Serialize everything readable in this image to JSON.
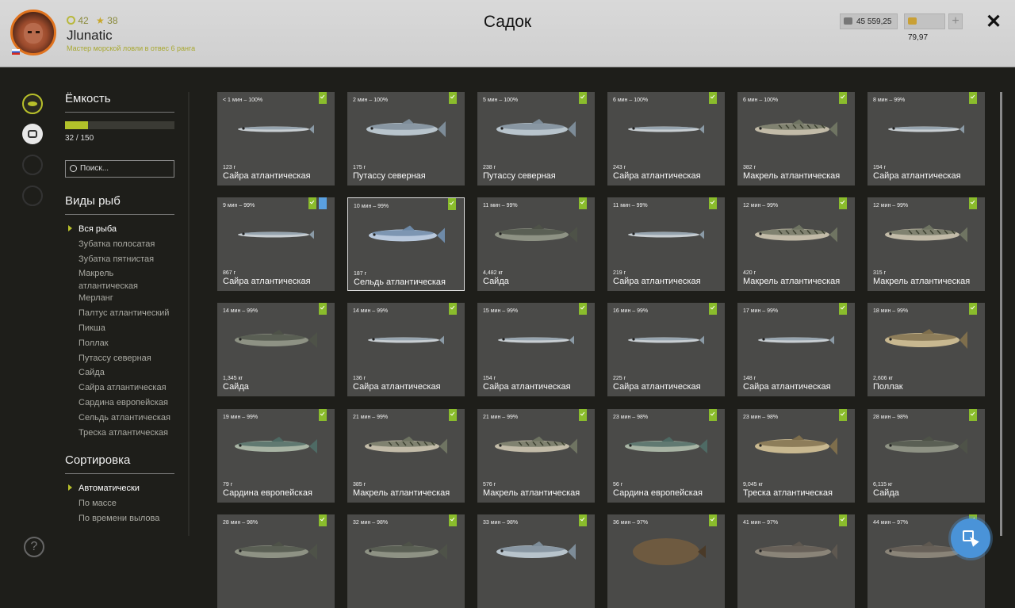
{
  "player": {
    "level": "42",
    "rank_num": "38",
    "name": "Jlunatic",
    "rank_title": "Мастер морской ловли в отвес 6 ранга"
  },
  "window_title": "Садок",
  "currency": {
    "silver": "45 559,25",
    "gold": "79,97",
    "add": "+"
  },
  "close": "✕",
  "capacity": {
    "title": "Ёмкость",
    "text": "32 / 150",
    "fill_fraction": 0.2133
  },
  "search": {
    "placeholder": "Поиск..."
  },
  "species": {
    "title": "Виды рыб",
    "items": [
      "Вся рыба",
      "Зубатка полосатая",
      "Зубатка пятнистая",
      "Макрель атлантическая",
      "Мерланг",
      "Палтус атлантический",
      "Пикша",
      "Поллак",
      "Путассу северная",
      "Сайда",
      "Сайра атлантическая",
      "Сардина европейская",
      "Сельдь атлантическая",
      "Треска атлантическая"
    ],
    "selected": 0
  },
  "sort": {
    "title": "Сортировка",
    "items": [
      "Автоматически",
      "По массе",
      "По времени вылова"
    ],
    "selected": 0
  },
  "help": "?",
  "colors": {
    "accent": "#b2c22a",
    "check": "#8abc2c",
    "fab": "#4a93d8"
  },
  "fish": [
    {
      "time": "< 1 мин – 100%",
      "weight": "123 г",
      "name": "Сайра атлантическая",
      "kind": "saury"
    },
    {
      "time": "2 мин – 100%",
      "weight": "175 г",
      "name": "Путассу северная",
      "kind": "whiting"
    },
    {
      "time": "5 мин – 100%",
      "weight": "238 г",
      "name": "Путассу северная",
      "kind": "whiting"
    },
    {
      "time": "6 мин – 100%",
      "weight": "243 г",
      "name": "Сайра атлантическая",
      "kind": "saury"
    },
    {
      "time": "6 мин – 100%",
      "weight": "382 г",
      "name": "Макрель атлантическая",
      "kind": "mackerel"
    },
    {
      "time": "8 мин – 99%",
      "weight": "194 г",
      "name": "Сайра атлантическая",
      "kind": "saury"
    },
    {
      "time": "9 мин – 99%",
      "weight": "867 г",
      "name": "Сайра атлантическая",
      "kind": "saury",
      "extra": true
    },
    {
      "time": "10 мин – 99%",
      "weight": "187 г",
      "name": "Сельдь атлантическая",
      "kind": "herring",
      "highlight": true
    },
    {
      "time": "11 мин – 99%",
      "weight": "4,482 кг",
      "name": "Сайда",
      "kind": "pollock"
    },
    {
      "time": "11 мин – 99%",
      "weight": "219 г",
      "name": "Сайра атлантическая",
      "kind": "saury"
    },
    {
      "time": "12 мин – 99%",
      "weight": "420 г",
      "name": "Макрель атлантическая",
      "kind": "mackerel"
    },
    {
      "time": "12 мин – 99%",
      "weight": "315 г",
      "name": "Макрель атлантическая",
      "kind": "mackerel"
    },
    {
      "time": "14 мин – 99%",
      "weight": "1,345 кг",
      "name": "Сайда",
      "kind": "pollock"
    },
    {
      "time": "14 мин – 99%",
      "weight": "136 г",
      "name": "Сайра атлантическая",
      "kind": "saury"
    },
    {
      "time": "15 мин – 99%",
      "weight": "154 г",
      "name": "Сайра атлантическая",
      "kind": "saury"
    },
    {
      "time": "16 мин – 99%",
      "weight": "225 г",
      "name": "Сайра атлантическая",
      "kind": "saury"
    },
    {
      "time": "17 мин – 99%",
      "weight": "148 г",
      "name": "Сайра атлантическая",
      "kind": "saury"
    },
    {
      "time": "18 мин – 99%",
      "weight": "2,606 кг",
      "name": "Поллак",
      "kind": "cod"
    },
    {
      "time": "19 мин – 99%",
      "weight": "79 г",
      "name": "Сардина европейская",
      "kind": "sardine"
    },
    {
      "time": "21 мин – 99%",
      "weight": "385 г",
      "name": "Макрель атлантическая",
      "kind": "mackerel"
    },
    {
      "time": "21 мин – 99%",
      "weight": "576 г",
      "name": "Макрель атлантическая",
      "kind": "mackerel"
    },
    {
      "time": "23 мин – 98%",
      "weight": "56 г",
      "name": "Сардина европейская",
      "kind": "sardine"
    },
    {
      "time": "23 мин – 98%",
      "weight": "9,045 кг",
      "name": "Треска атлантическая",
      "kind": "cod"
    },
    {
      "time": "28 мин – 98%",
      "weight": "6,115 кг",
      "name": "Сайда",
      "kind": "pollock"
    },
    {
      "time": "28 мин – 98%",
      "weight": "",
      "name": "",
      "kind": "pollock"
    },
    {
      "time": "32 мин – 98%",
      "weight": "",
      "name": "",
      "kind": "pollock"
    },
    {
      "time": "33 мин – 98%",
      "weight": "",
      "name": "",
      "kind": "whiting"
    },
    {
      "time": "36 мин – 97%",
      "weight": "",
      "name": "",
      "kind": "flatfish"
    },
    {
      "time": "41 мин – 97%",
      "weight": "",
      "name": "",
      "kind": "wolffish"
    },
    {
      "time": "44 мин – 97%",
      "weight": "",
      "name": "",
      "kind": "wolffish"
    }
  ]
}
